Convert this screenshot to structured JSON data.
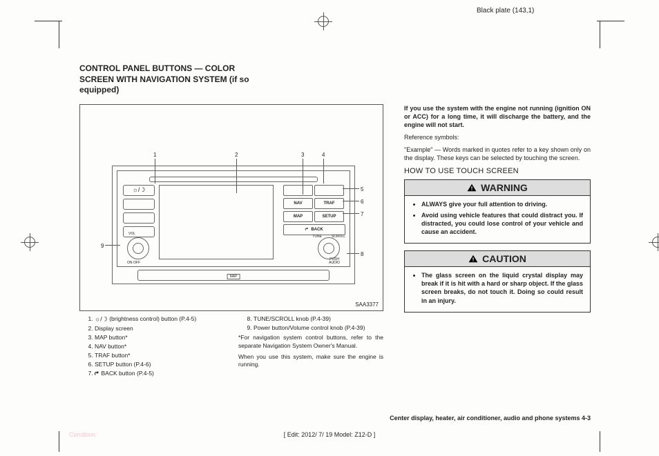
{
  "plate": "Black plate (143,1)",
  "title": "CONTROL PANEL BUTTONS — COLOR SCREEN WITH NAVIGATION SYSTEM (if so equipped)",
  "figure": {
    "id": "SAA3377",
    "buttons": {
      "nav": "NAV",
      "traf": "TRAF",
      "map": "MAP",
      "setup": "SETUP",
      "back": "BACK"
    },
    "labels": {
      "vol": "VOL",
      "onoff": "ON·OFF",
      "tune": "TUNE",
      "scroll": "SCROLL",
      "push": "PUSH AUDIO",
      "mapTag": "MAP"
    },
    "callouts": [
      "1",
      "2",
      "3",
      "4",
      "5",
      "6",
      "7",
      "8",
      "9"
    ]
  },
  "legendLeft": [
    " (brightness control) button (P.4-5)",
    "Display screen",
    "MAP button*",
    "NAV button*",
    "TRAF button*",
    "SETUP button (P.4-6)",
    " BACK button (P.4-5)"
  ],
  "legendRight": {
    "items": [
      "TUNE/SCROLL knob (P.4-39)",
      "Power button/Volume control knob (P.4-39)"
    ],
    "note1": "*For navigation system control buttons, refer to the separate Navigation System Owner's Manual.",
    "note2": "When you use this system, make sure the engine is running."
  },
  "right": {
    "para1": "If you use the system with the engine not running (ignition ON or ACC) for a long time, it will discharge the battery, and the engine will not start.",
    "refLabel": "Reference symbols:",
    "refText": "\"Example\" — Words marked in quotes refer to a key shown only on the display. These keys can be selected by touching the screen.",
    "subhead": "HOW TO USE TOUCH SCREEN",
    "warning": {
      "title": "WARNING",
      "items": [
        {
          "bold": "ALWAYS ",
          "rest": "give your full attention to driving."
        },
        {
          "bold": "",
          "rest": "Avoid using vehicle features that could distract you. If distracted, you could lose control of your vehicle and cause an accident."
        }
      ]
    },
    "caution": {
      "title": "CAUTION",
      "items": [
        {
          "bold": "",
          "rest": "The glass screen on the liquid crystal display may break if it is hit with a hard or sharp object. If the glass screen breaks, do not touch it. Doing so could result in an injury."
        }
      ]
    }
  },
  "footerSection": "Center display, heater, air conditioner, audio and phone systems    4-3",
  "footerEdit": "[ Edit: 2012/ 7/ 19   Model: Z12-D ]",
  "condition": "Condition:"
}
